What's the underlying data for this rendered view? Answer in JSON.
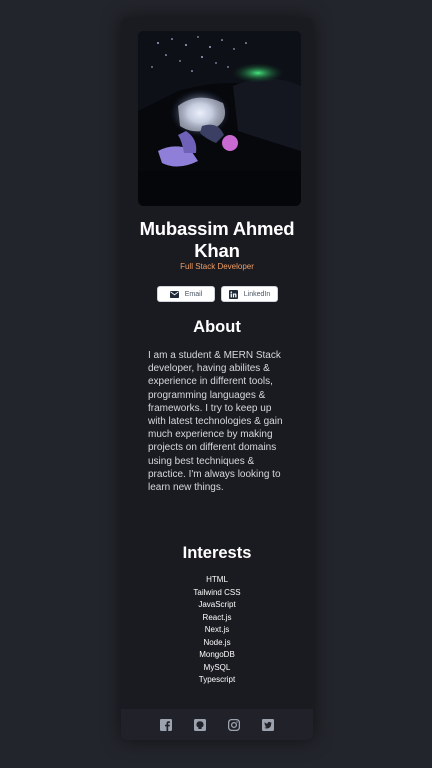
{
  "profile": {
    "photo": "profile-photo",
    "name": "Mubassim Ahmed Khan",
    "role": "Full Stack Developer"
  },
  "contact": {
    "email_label": "Email",
    "email_icon": "envelope-icon",
    "linkedin_label": "LinkedIn",
    "linkedin_icon": "linkedin-icon"
  },
  "about": {
    "heading": "About",
    "text": "I am a student & MERN Stack developer, having abilites & experience in different tools, programming languages & frameworks. I try to keep up with latest technologies & gain much experience by making projects on different domains using best techniques & practice. I'm always looking to learn new things."
  },
  "interests": {
    "heading": "Interests",
    "items": [
      "HTML",
      "Tailwind CSS",
      "JavaScript",
      "React.js",
      "Next.js",
      "Node.js",
      "MongoDB",
      "MySQL",
      "Typescript"
    ]
  },
  "footer": {
    "icons": [
      "facebook-icon",
      "github-icon",
      "instagram-icon",
      "twitter-icon"
    ]
  },
  "colors": {
    "page_bg": "#23252c",
    "card_bg": "#1a1b21",
    "footer_bg": "#212229",
    "accent": "#f29d63",
    "text": "#ffffff",
    "icon": "#9ca3af"
  }
}
